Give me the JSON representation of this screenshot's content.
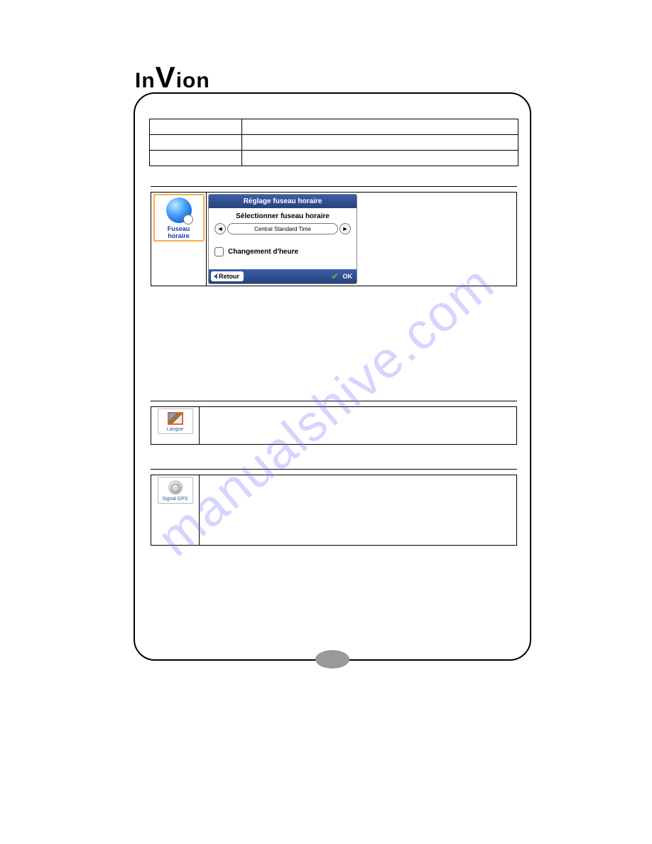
{
  "brand": "InVion",
  "watermark": "manualshive.com",
  "timezone_thumb_label": "Fuseau horaire",
  "screenshot": {
    "title": "Réglage fuseau horaire",
    "subtitle": "Sélectionner fuseau horaire",
    "value": "Central Standard Time",
    "dst_label": "Changement d'heure",
    "back": "Retour",
    "ok": "OK"
  },
  "langue_label": "Langue",
  "gps_label": "Signal GPS"
}
